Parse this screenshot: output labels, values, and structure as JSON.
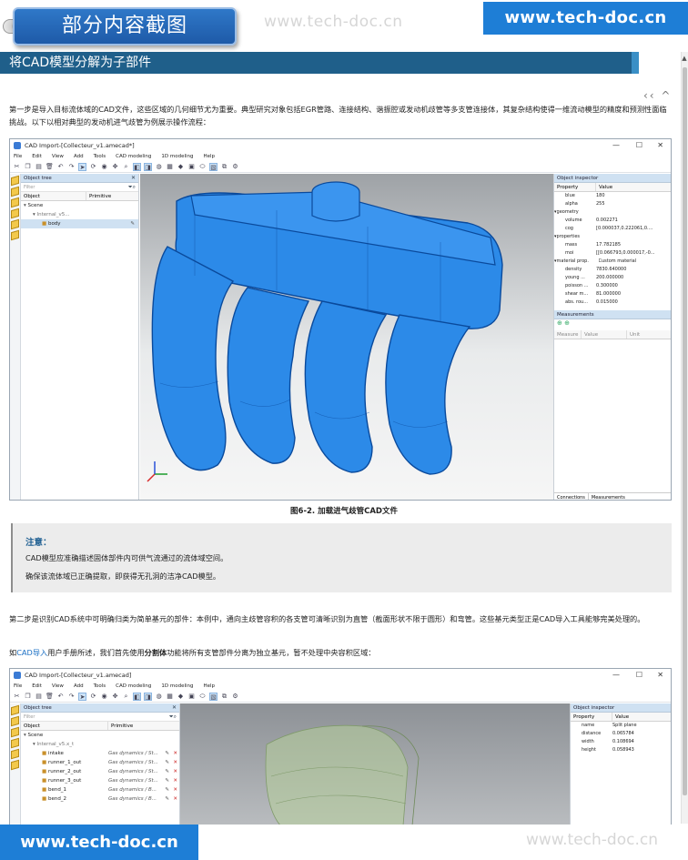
{
  "banner": {
    "tag": "部分内容截图",
    "brand_top": "www.tech-doc.cn",
    "brand_bottom": "www.tech-doc.cn",
    "watermark": "www.tech-doc.cn"
  },
  "section": {
    "title": "将CAD模型分解为子部件"
  },
  "nav": "‹‹ ^",
  "para1": "第一步是导入目标流体域的CAD文件，这些区域的几何细节尤为重要。典型研究对象包括EGR管路、连接结构、谐振腔或发动机歧管等多支管连接体，其复杂结构使得一维流动模型的精度和预测性面临挑战。以下以相对典型的发动机进气歧管为例展示操作流程：",
  "figure1": {
    "caption": "图6-2. 加载进气歧管CAD文件",
    "window_title": "CAD Import-[Collecteur_v1.amecad*]",
    "menu": [
      "File",
      "Edit",
      "View",
      "Add",
      "Tools",
      "CAD modeling",
      "1D modeling",
      "Help"
    ],
    "object_tree": {
      "title": "Object tree",
      "filter": "Filter",
      "columns": [
        "Object",
        "Primitive"
      ],
      "rows": [
        {
          "label": "Scene",
          "depth": 0
        },
        {
          "label": "Internal_v5...",
          "depth": 1
        },
        {
          "label": "body",
          "depth": 2,
          "selected": true
        }
      ]
    },
    "inspector": {
      "title": "Object inspector",
      "columns": [
        "Property",
        "Value"
      ],
      "rows": [
        {
          "k": "blue",
          "v": "180",
          "d": 2
        },
        {
          "k": "alpha",
          "v": "255",
          "d": 2
        },
        {
          "k": "geometry",
          "v": "",
          "d": 0
        },
        {
          "k": "volume",
          "v": "0.002271",
          "d": 2
        },
        {
          "k": "cog",
          "v": "[0.000037,0.222061,0....",
          "d": 2
        },
        {
          "k": "properties",
          "v": "",
          "d": 0
        },
        {
          "k": "mass",
          "v": "17.782185",
          "d": 2
        },
        {
          "k": "moi",
          "v": "[[0.066793,0.000017,-0...",
          "d": 2
        },
        {
          "k": "material prop.",
          "v": "Custom material",
          "d": 0
        },
        {
          "k": "density",
          "v": "7830.640000",
          "d": 2
        },
        {
          "k": "young ...",
          "v": "200.000000",
          "d": 2
        },
        {
          "k": "poisson ...",
          "v": "0.300000",
          "d": 2
        },
        {
          "k": "shear m...",
          "v": "81.000000",
          "d": 2
        },
        {
          "k": "abs. rou...",
          "v": "0.015000",
          "d": 2
        }
      ]
    },
    "measurements": {
      "title": "Measurements",
      "columns": [
        "Measure",
        "Value",
        "Unit"
      ],
      "tabs": [
        "Connections",
        "Measurements"
      ]
    }
  },
  "note": {
    "title": "注意：",
    "line1": "CAD模型应准确描述固体部件内可供气流通过的流体域空间。",
    "line2": "确保该流体域已正确提取，即获得无孔洞的洁净CAD模型。"
  },
  "para2": "第二步是识别CAD系统中可明确归类为简单基元的部件：本例中，通向主歧管容积的各支管可清晰识别为直管（截面形状不限于圆形）和弯管。这些基元类型正是CAD导入工具能够完美处理的。",
  "para3": {
    "pre": "如",
    "link": "CAD导入",
    "mid": "用户手册所述，我们首先使用",
    "bold": "分割体",
    "post": "功能将所有支管部件分离为独立基元，暂不处理中央容积区域："
  },
  "figure2": {
    "window_title": "CAD Import-[Collecteur_v1.amecad]",
    "menu": [
      "File",
      "Edit",
      "View",
      "Add",
      "Tools",
      "CAD modeling",
      "1D modeling",
      "Help"
    ],
    "object_tree": {
      "title": "Object tree",
      "filter": "Filter",
      "columns": [
        "Object",
        "Primitive"
      ],
      "rows": [
        {
          "label": "Scene",
          "prim": "",
          "depth": 0
        },
        {
          "label": "Internal_v5.x_t",
          "prim": "",
          "depth": 1
        },
        {
          "label": "intake",
          "prim": "Gas dynamics / St...",
          "depth": 2
        },
        {
          "label": "runner_1_out",
          "prim": "Gas dynamics / St...",
          "depth": 2
        },
        {
          "label": "runner_2_out",
          "prim": "Gas dynamics / St...",
          "depth": 2
        },
        {
          "label": "runner_3_out",
          "prim": "Gas dynamics / St...",
          "depth": 2
        },
        {
          "label": "bend_1",
          "prim": "Gas dynamics / B...",
          "depth": 2
        },
        {
          "label": "bend_2",
          "prim": "Gas dynamics / B...",
          "depth": 2
        }
      ]
    },
    "inspector": {
      "title": "Object inspector",
      "columns": [
        "Property",
        "Value"
      ],
      "rows": [
        {
          "k": "name",
          "v": "Split plane"
        },
        {
          "k": "distance",
          "v": "0.065784"
        },
        {
          "k": "width",
          "v": "0.108694"
        },
        {
          "k": "height",
          "v": "0.058943"
        }
      ]
    }
  }
}
